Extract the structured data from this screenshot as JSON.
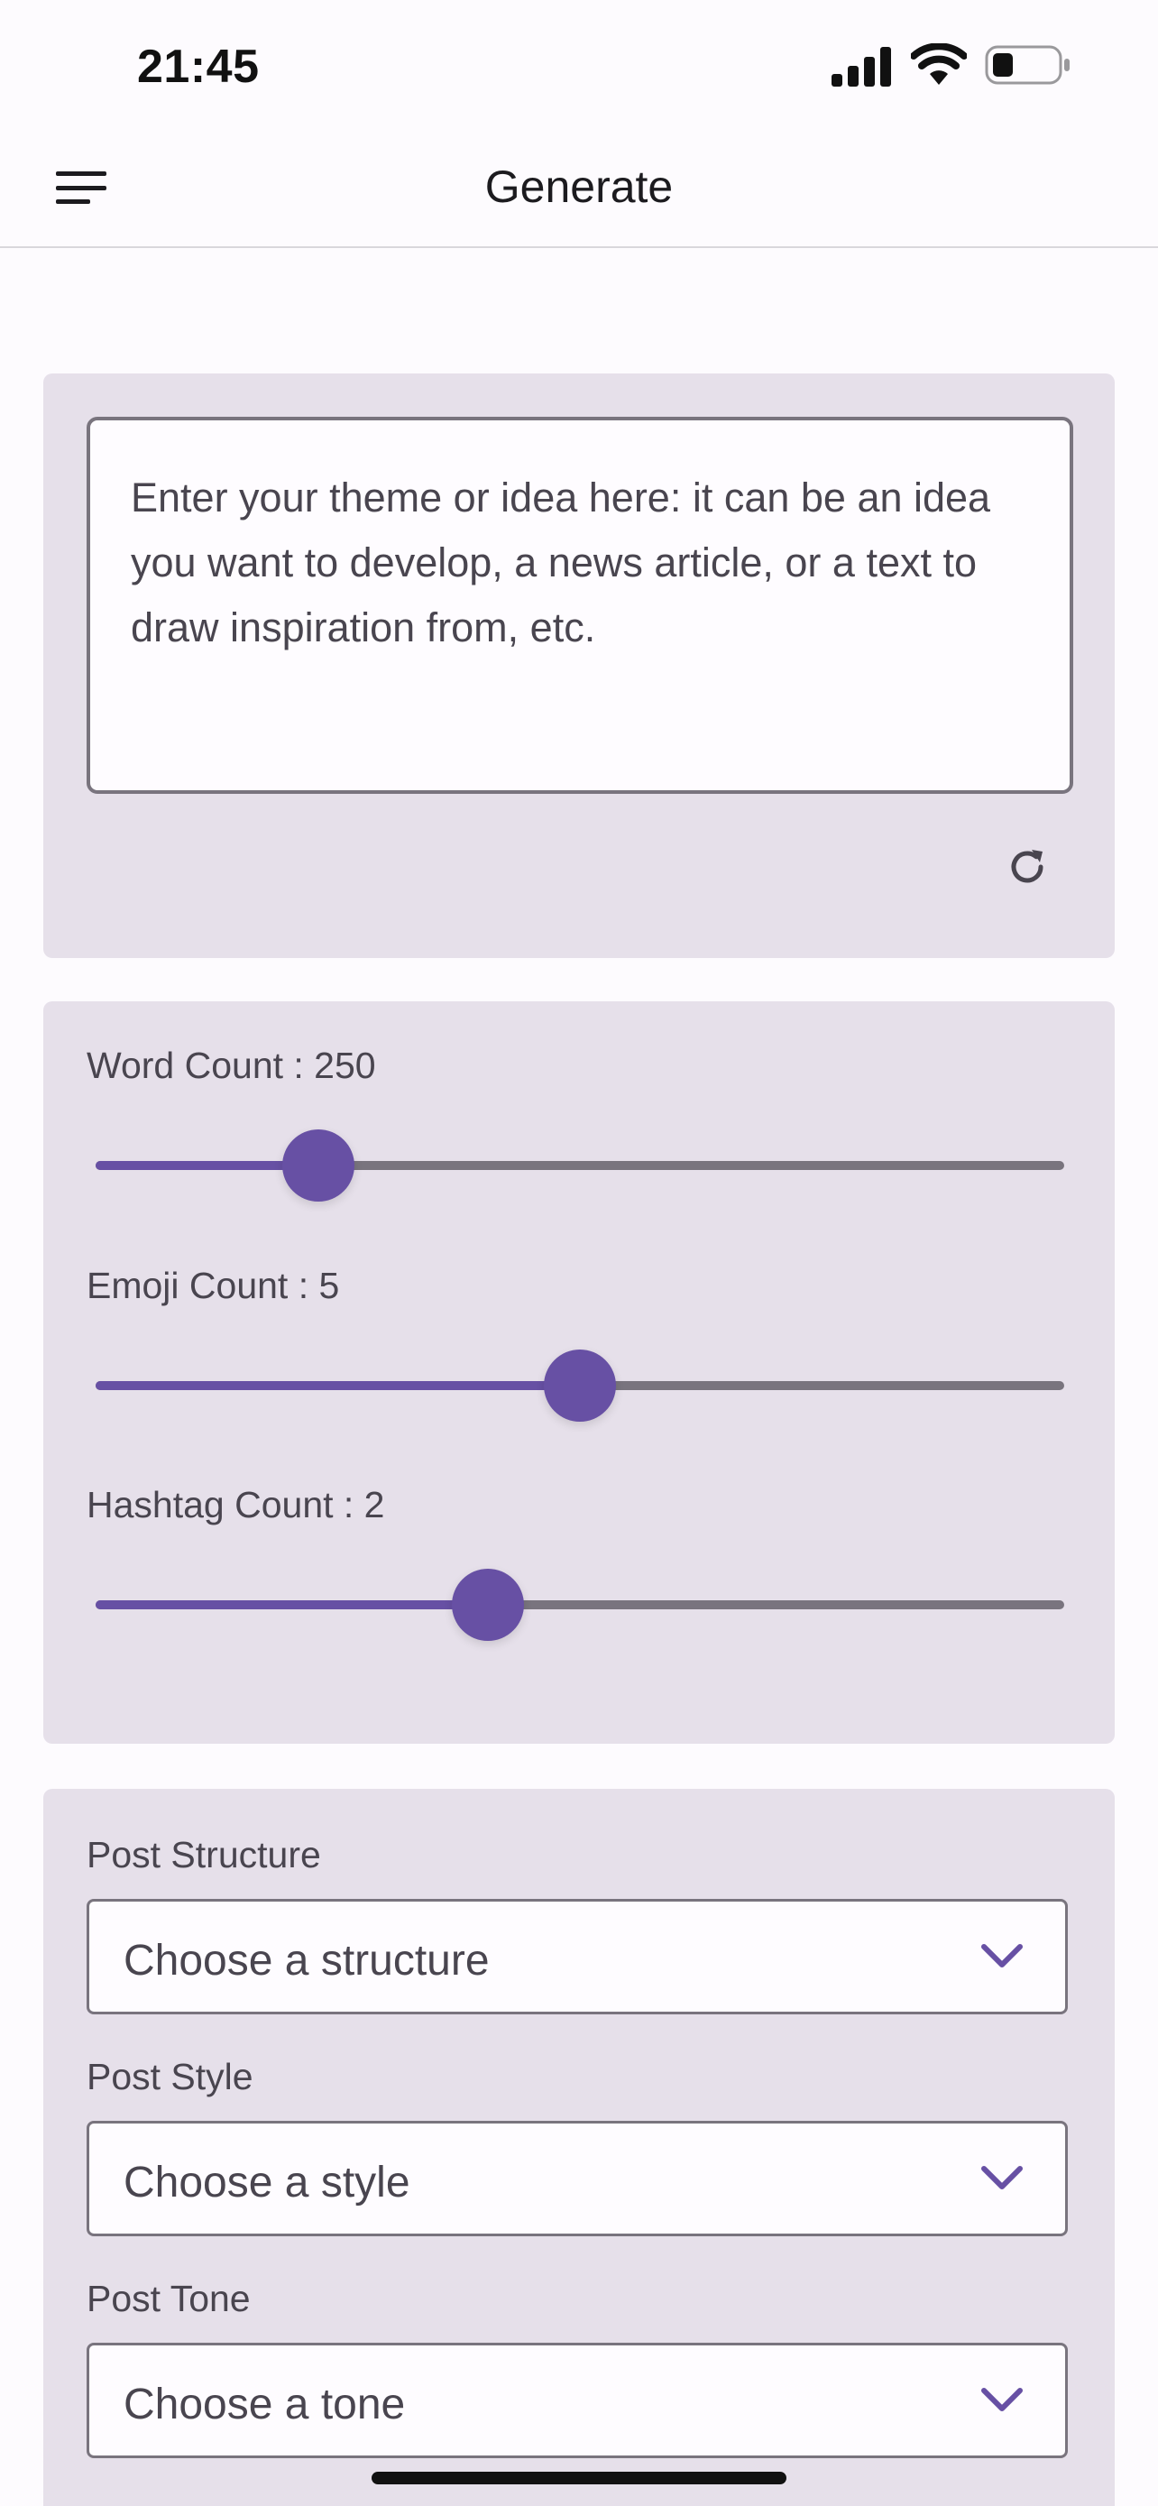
{
  "status_bar": {
    "time": "21:45",
    "icons": [
      "signal-icon",
      "wifi-icon",
      "battery-icon"
    ]
  },
  "app_bar": {
    "title": "Generate",
    "menu_icon": "hamburger-menu-icon"
  },
  "theme_card": {
    "placeholder": "Enter your theme or idea here: it can be an idea you want to develop, a news article, or a text to draw inspiration from, etc.",
    "value": "",
    "refresh_icon": "refresh-icon"
  },
  "sliders": [
    {
      "label": "Word Count : 250",
      "fraction": 0.23
    },
    {
      "label": "Emoji Count : 5",
      "fraction": 0.5
    },
    {
      "label": "Hashtag Count : 2",
      "fraction": 0.405
    }
  ],
  "options": [
    {
      "label": "Post Structure",
      "value": "Choose a structure"
    },
    {
      "label": "Post Style",
      "value": "Choose a style"
    },
    {
      "label": "Post Tone",
      "value": "Choose a tone"
    }
  ],
  "colors": {
    "accent": "#6750a4",
    "card_background": "#e6e0ea",
    "track_inactive": "#79747e",
    "text_secondary": "#49454f"
  }
}
